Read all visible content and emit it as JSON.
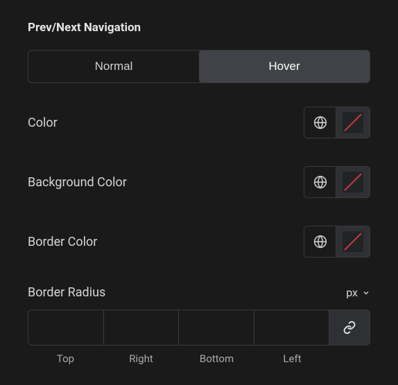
{
  "section": {
    "title": "Prev/Next Navigation"
  },
  "tabs": {
    "normal": "Normal",
    "hover": "Hover",
    "active": "hover"
  },
  "fields": {
    "color": {
      "label": "Color"
    },
    "bgcolor": {
      "label": "Background Color"
    },
    "bordercolor": {
      "label": "Border Color"
    },
    "borderradius": {
      "label": "Border Radius",
      "unit": "px",
      "sides": {
        "top": "Top",
        "right": "Right",
        "bottom": "Bottom",
        "left": "Left"
      },
      "values": {
        "top": "",
        "right": "",
        "bottom": "",
        "left": ""
      }
    }
  },
  "colors": {
    "slash": "#cc3b44",
    "panel": "#1a1a1a"
  }
}
